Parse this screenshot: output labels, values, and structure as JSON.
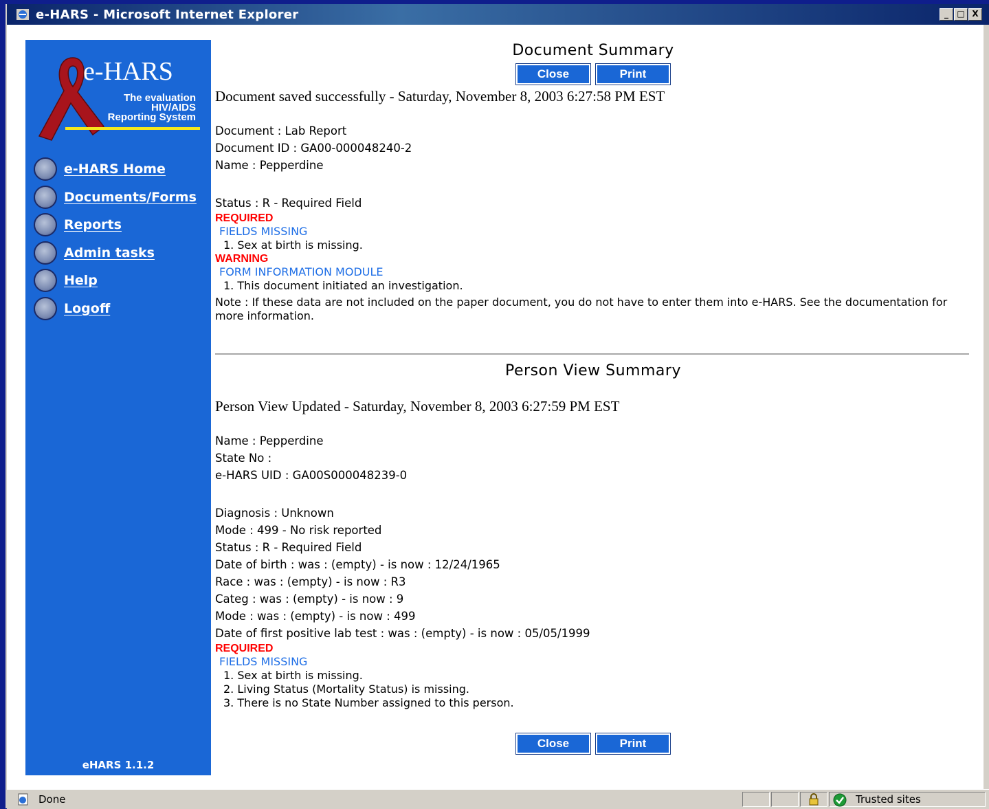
{
  "window": {
    "title": "e-HARS - Microsoft Internet Explorer",
    "controls": [
      "_",
      "□",
      "X"
    ]
  },
  "sidebar": {
    "logo": {
      "title": "e-HARS",
      "subtitle_lines": [
        "The evaluation",
        "HIV/AIDS",
        "Reporting System"
      ]
    },
    "items": [
      {
        "label": "e-HARS Home",
        "icon": "radio-bullet-icon"
      },
      {
        "label": "Documents/Forms",
        "icon": "radio-bullet-icon"
      },
      {
        "label": "Reports",
        "icon": "radio-bullet-icon"
      },
      {
        "label": "Admin tasks",
        "icon": "radio-bullet-icon"
      },
      {
        "label": "Help",
        "icon": "radio-bullet-icon"
      },
      {
        "label": "Logoff",
        "icon": "radio-bullet-icon"
      }
    ],
    "version": "eHARS 1.1.2"
  },
  "document_summary": {
    "heading": "Document Summary",
    "close_label": "Close",
    "print_label": "Print",
    "saved_message": "Document saved successfully - Saturday, November 8, 2003 6:27:58 PM EST",
    "document": "Document : Lab Report",
    "document_id": "Document ID : GA00-000048240-2",
    "name": "Name : Pepperdine",
    "status": "Status : R - Required Field",
    "required_label": "REQUIRED",
    "fields_missing_label": "FIELDS MISSING",
    "required_items": [
      "1. Sex at birth is missing."
    ],
    "warning_label": "WARNING",
    "form_info_label": "FORM INFORMATION MODULE",
    "warning_items": [
      "1. This document initiated an investigation."
    ],
    "note": "Note : If these data are not included on the paper document, you do not have to enter them into e-HARS. See the documentation for more information."
  },
  "person_summary": {
    "heading": "Person View Summary",
    "updated_message": "Person View Updated - Saturday, November 8, 2003 6:27:59 PM EST",
    "name": "Name : Pepperdine",
    "state_no": "State No :",
    "uid": "e-HARS UID : GA00S000048239-0",
    "diagnosis": "Diagnosis : Unknown",
    "mode": "Mode : 499 - No risk reported",
    "status": "Status : R - Required Field",
    "changes": [
      "Date of birth : was : (empty) - is now : 12/24/1965",
      "Race : was : (empty) - is now : R3",
      "Categ : was : (empty) - is now : 9",
      "Mode : was : (empty) - is now : 499",
      "Date of first positive lab test : was : (empty) - is now : 05/05/1999"
    ],
    "required_label": "REQUIRED",
    "fields_missing_label": "FIELDS MISSING",
    "required_items": [
      "1. Sex at birth is missing.",
      "2. Living Status (Mortality Status) is missing.",
      "3. There is no State Number assigned to this person."
    ],
    "close_label": "Close",
    "print_label": "Print"
  },
  "statusbar": {
    "text": "Done",
    "zone": "Trusted sites"
  },
  "colors": {
    "sidebar": "#1a67d6",
    "required": "#ff0000",
    "section_label": "#1e6ee6"
  }
}
